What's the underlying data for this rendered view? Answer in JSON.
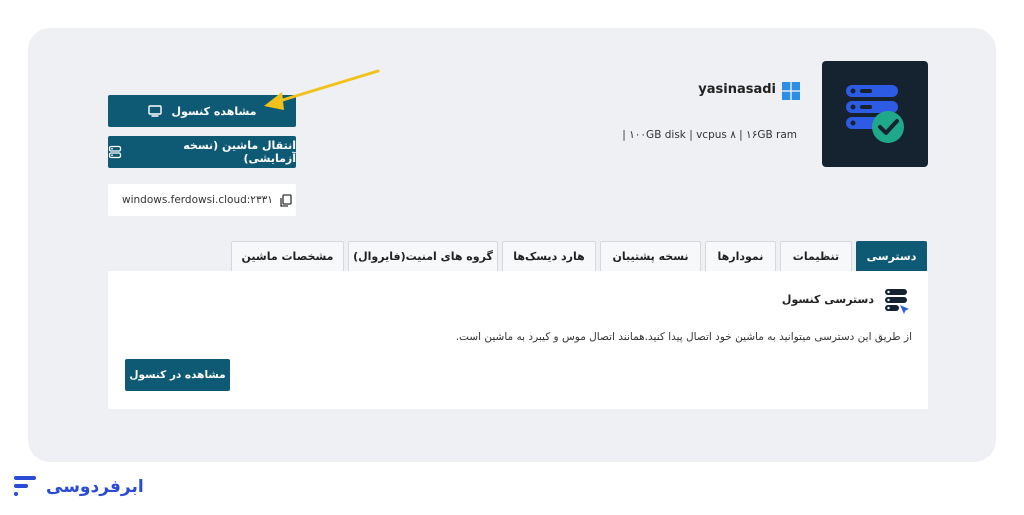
{
  "vm": {
    "name": "yasinasadi",
    "specs": "| ۱۰۰GB disk | vcpus ۸ | ۱۶GB ram"
  },
  "actions": {
    "console_label": "مشاهده کنسول",
    "migrate_label": "انتقال ماشین (نسخه آزمایشی)",
    "address": "windows.ferdowsi.cloud:۲۳۳۱"
  },
  "tabs": [
    {
      "label": "دسترسی",
      "active": true
    },
    {
      "label": "تنظیمات",
      "active": false
    },
    {
      "label": "نمودارها",
      "active": false
    },
    {
      "label": "نسخه پشتیبان",
      "active": false
    },
    {
      "label": "هارد دیسک‌ها",
      "active": false
    },
    {
      "label": "گروه های امنیت(فایروال)",
      "active": false
    },
    {
      "label": "مشخصات ماشین",
      "active": false
    }
  ],
  "panel": {
    "title": "دسترسی کنسول",
    "description": "از طریق این دسترسی میتوانید به ماشین خود اتصال پیدا کنید.همانند اتصال موس و کیبرد به ماشین است.",
    "button_label": "مشاهده در کنسول"
  },
  "brand": {
    "name": "ابرفردوسی"
  },
  "colors": {
    "primary": "#0e5a74",
    "icon_bg": "#14232f",
    "icon_accent": "#2d5be3",
    "check": "#1fa88a",
    "arrow": "#f2c21b",
    "brand": "#2a4bd6"
  }
}
